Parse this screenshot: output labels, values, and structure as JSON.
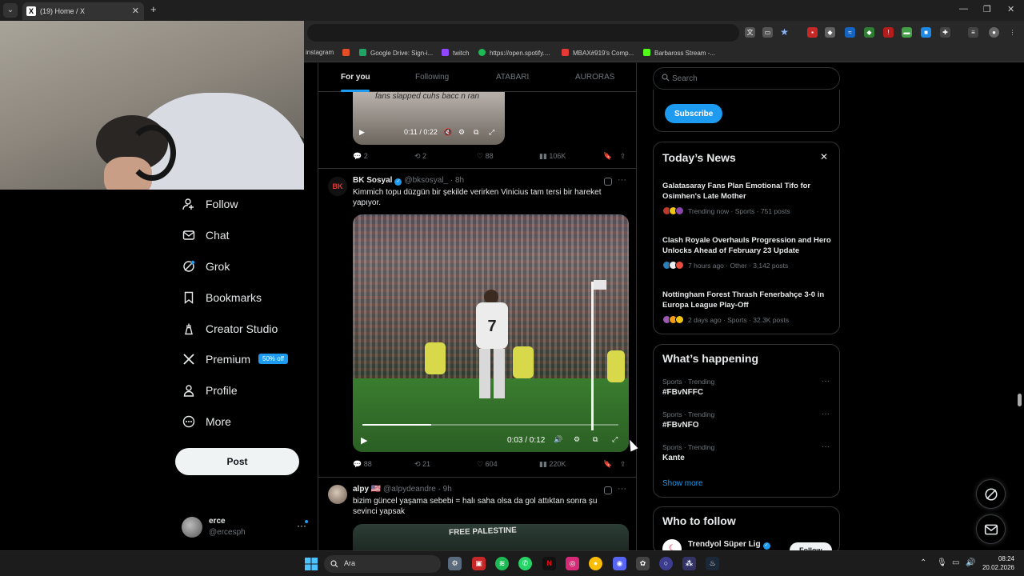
{
  "browser": {
    "tab_title": "(19) Home / X",
    "tab_close": "✕",
    "new_tab": "+",
    "window_controls": [
      "—",
      "❐",
      "✕"
    ],
    "bookmarks": [
      {
        "label": "instagram",
        "color": "#e1306c"
      },
      {
        "label": "",
        "color": "#e44d26"
      },
      {
        "label": "Google Drive: Sign-i...",
        "color": "#1fa463"
      },
      {
        "label": "twitch",
        "color": "#9146ff"
      },
      {
        "label": "https://open.spotify....",
        "color": "#1db954"
      },
      {
        "label": "MBAX#919's Comp...",
        "color": "#e53935"
      },
      {
        "label": "Barbaross Stream -...",
        "color": "#53fc18"
      }
    ]
  },
  "sidebar": {
    "items": [
      {
        "label": "Follow",
        "icon": "follow-icon"
      },
      {
        "label": "Chat",
        "icon": "chat-icon"
      },
      {
        "label": "Grok",
        "icon": "grok-icon"
      },
      {
        "label": "Bookmarks",
        "icon": "bookmark-icon"
      },
      {
        "label": "Creator Studio",
        "icon": "creator-studio-icon"
      },
      {
        "label": "Premium",
        "icon": "x-premium-icon"
      },
      {
        "label": "Profile",
        "icon": "profile-icon"
      },
      {
        "label": "More",
        "icon": "more-icon"
      }
    ],
    "premium_badge": "50% off",
    "post_button": "Post",
    "account": {
      "name": "erce",
      "handle": "@ercesph",
      "more": "···"
    }
  },
  "feed": {
    "tabs": [
      "For you",
      "Following",
      "ATABARI",
      "AURORAS"
    ],
    "active_tab": "For you",
    "tweet1": {
      "video_caption": "fans slapped cuhs bacc n ran",
      "video_time": "0:11 / 0:22",
      "replies": "2",
      "reposts": "2",
      "likes": "88",
      "views": "106K"
    },
    "tweet2": {
      "avatar_text": "BK",
      "name": "BK Sosyal",
      "handle": "@bksosyal_",
      "time": "· 8h",
      "text": "Kimmich topu düzgün bir şekilde verirken Vinicius tam tersi bir hareket yapıyor.",
      "jersey_number": "7",
      "video_time": "0:03 / 0:12",
      "video_progress": 0.27,
      "replies": "88",
      "reposts": "21",
      "likes": "604",
      "views": "220K"
    },
    "tweet3": {
      "name": "alpy",
      "flag": "🇺🇸",
      "handle": "@aIpydeandre",
      "time": "· 9h",
      "text": "bizim güncel yaşama sebebi = halı saha olsa da gol attıktan sonra şu sevinci yapsak",
      "image_caption": "FREE PALESTINE"
    }
  },
  "right": {
    "search_placeholder": "Search",
    "subscribe_label": "Subscribe",
    "news": {
      "title": "Today’s News",
      "close": "✕",
      "items": [
        {
          "title": "Galatasaray Fans Plan Emotional Tifo for Osimhen's Late Mother",
          "meta": "Trending now · Sports · 751 posts"
        },
        {
          "title": "Clash Royale Overhauls Progression and Hero Unlocks Ahead of February 23 Update",
          "meta": "7 hours ago · Other · 3,142 posts"
        },
        {
          "title": "Nottingham Forest Thrash Fenerbahçe 3-0 in Europa League Play-Off",
          "meta": "2 days ago · Sports · 32.3K posts"
        }
      ]
    },
    "happening": {
      "title": "What’s happening",
      "items": [
        {
          "category": "Sports · Trending",
          "name": "#FBvNFFC"
        },
        {
          "category": "Sports · Trending",
          "name": "#FBvNFO"
        },
        {
          "category": "Sports · Trending",
          "name": "Kante"
        }
      ],
      "show_more": "Show more"
    },
    "who_to_follow": {
      "title": "Who to follow",
      "name": "Trendyol Süper Lig",
      "follow": "Follow"
    }
  },
  "taskbar": {
    "search_label": "Ara",
    "time": "08:24",
    "date": "20.02.2026"
  }
}
